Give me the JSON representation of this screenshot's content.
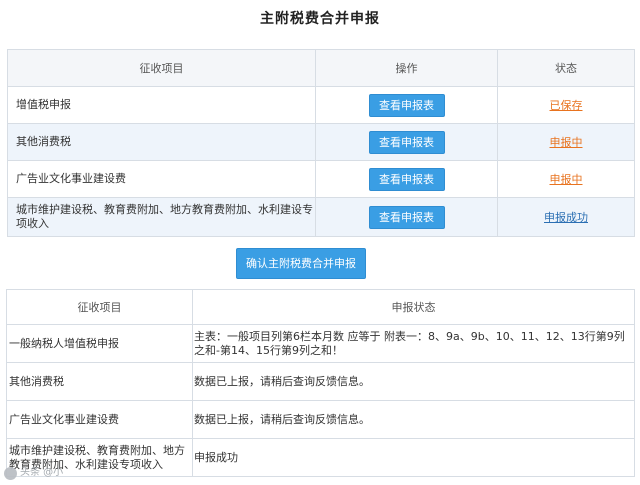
{
  "page_title": "主附税费合并申报",
  "top_table": {
    "headers": [
      "征收项目",
      "操作",
      "状态"
    ],
    "rows": [
      {
        "item": "增值税申报",
        "action": "查看申报表",
        "status": "已保存",
        "status_color": "#e8731f"
      },
      {
        "item": "其他消费税",
        "action": "查看申报表",
        "status": "申报中",
        "status_color": "#e8731f"
      },
      {
        "item": "广告业文化事业建设费",
        "action": "查看申报表",
        "status": "申报中",
        "status_color": "#e8731f"
      },
      {
        "item": "城市维护建设税、教育费附加、地方教育费附加、水利建设专项收入",
        "action": "查看申报表",
        "status": "申报成功",
        "status_color": "#2b6fb3"
      }
    ]
  },
  "confirm_button": "确认主附税费合并申报",
  "bottom_table": {
    "headers": [
      "征收项目",
      "申报状态"
    ],
    "rows": [
      {
        "item": "一般纳税人增值税申报",
        "status": "主表：一般项目列第6栏本月数 应等于 附表一：8、9a、9b、10、11、12、13行第9列之和-第14、15行第9列之和！"
      },
      {
        "item": "其他消费税",
        "status": "数据已上报，请稍后查询反馈信息。"
      },
      {
        "item": "广告业文化事业建设费",
        "status": "数据已上报，请稍后查询反馈信息。"
      },
      {
        "item": "城市维护建设税、教育费附加、地方教育费附加、水利建设专项收入",
        "status": "申报成功"
      }
    ]
  },
  "colors": {
    "primary_button": "#3a9ee4",
    "warning_status": "#e8731f",
    "success_status": "#2b6fb3",
    "alt_row": "#eef4fb"
  },
  "watermark": "头条 @小"
}
